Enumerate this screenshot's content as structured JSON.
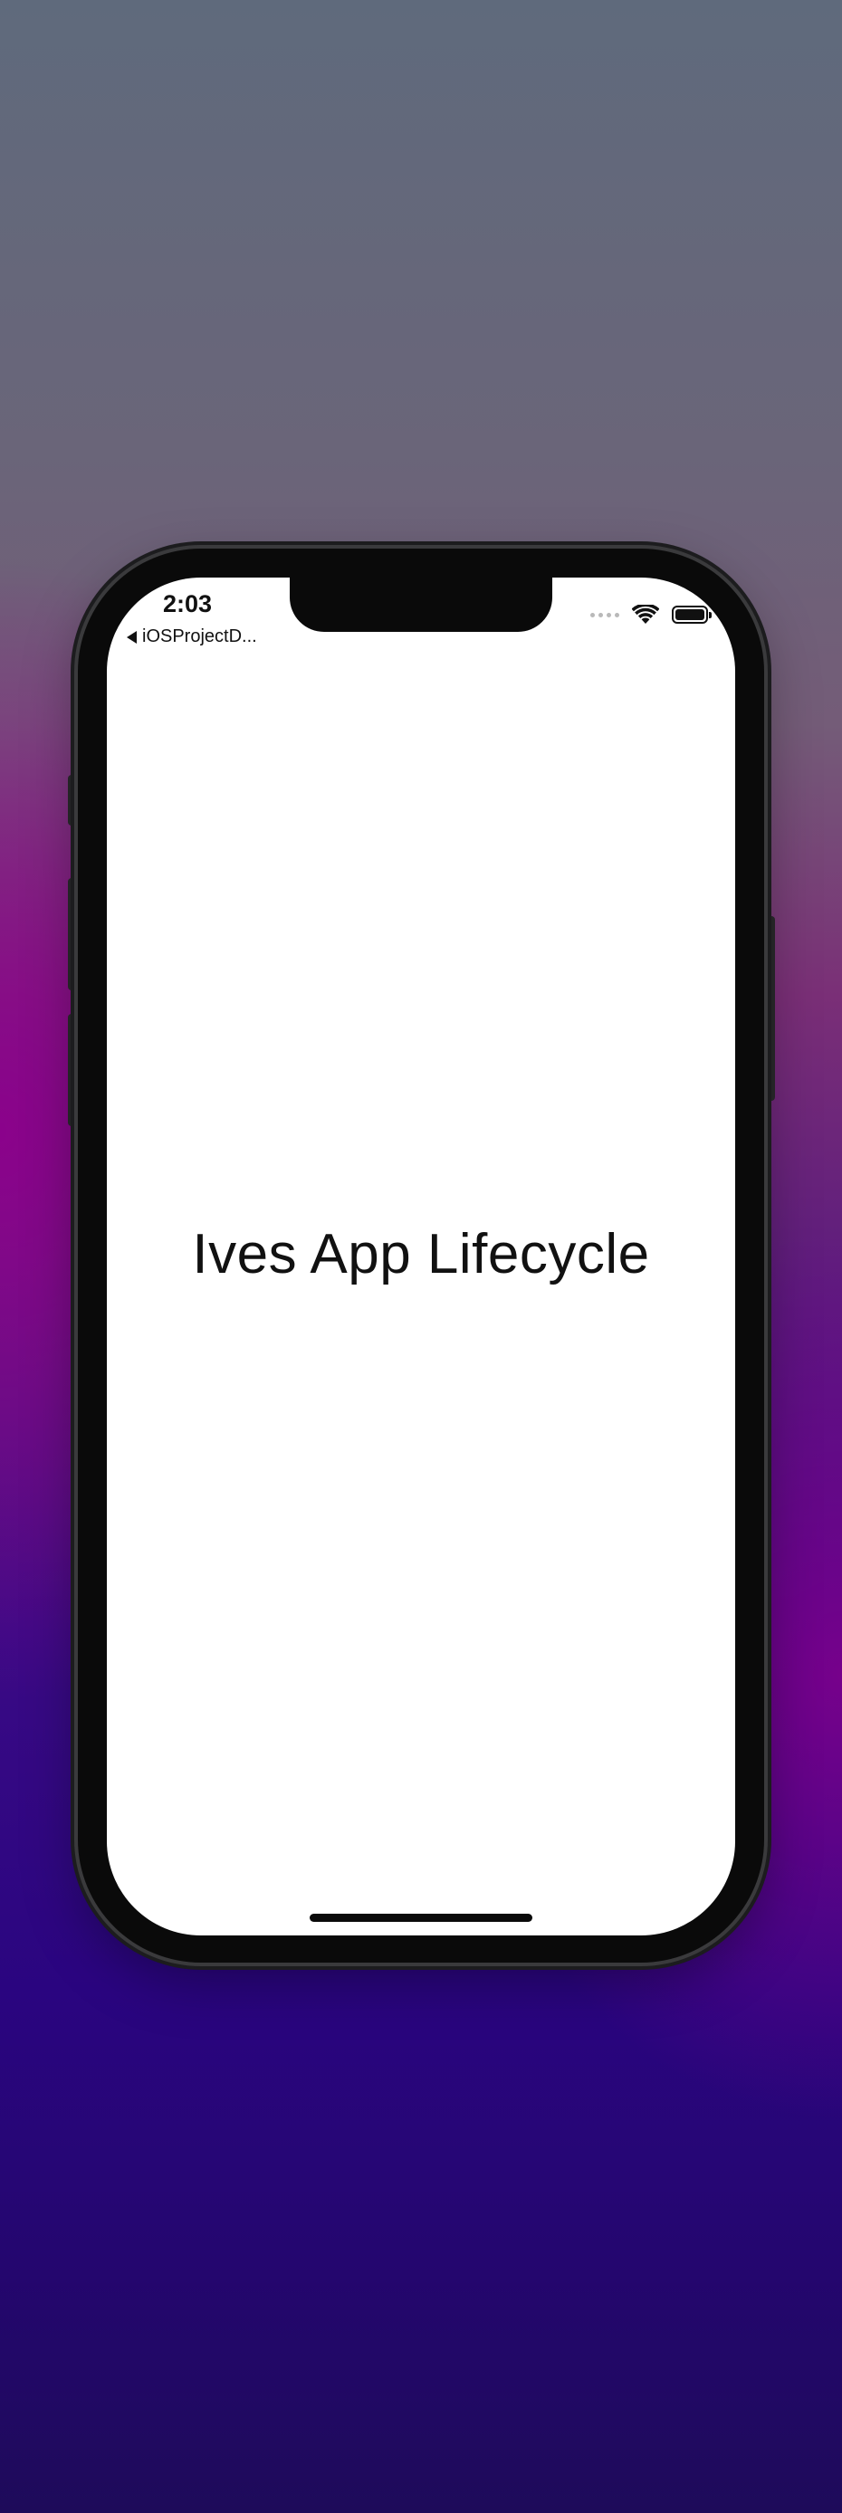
{
  "status_bar": {
    "time": "2:03",
    "back_label": "iOSProjectD...",
    "icons": [
      "signal-dots-icon",
      "wifi-icon",
      "battery-icon"
    ]
  },
  "content": {
    "title": "Ives App Lifecycle"
  },
  "colors": {
    "screen_background": "#ffffff",
    "text": "#111111",
    "device_frame": "#0a0a0a"
  }
}
